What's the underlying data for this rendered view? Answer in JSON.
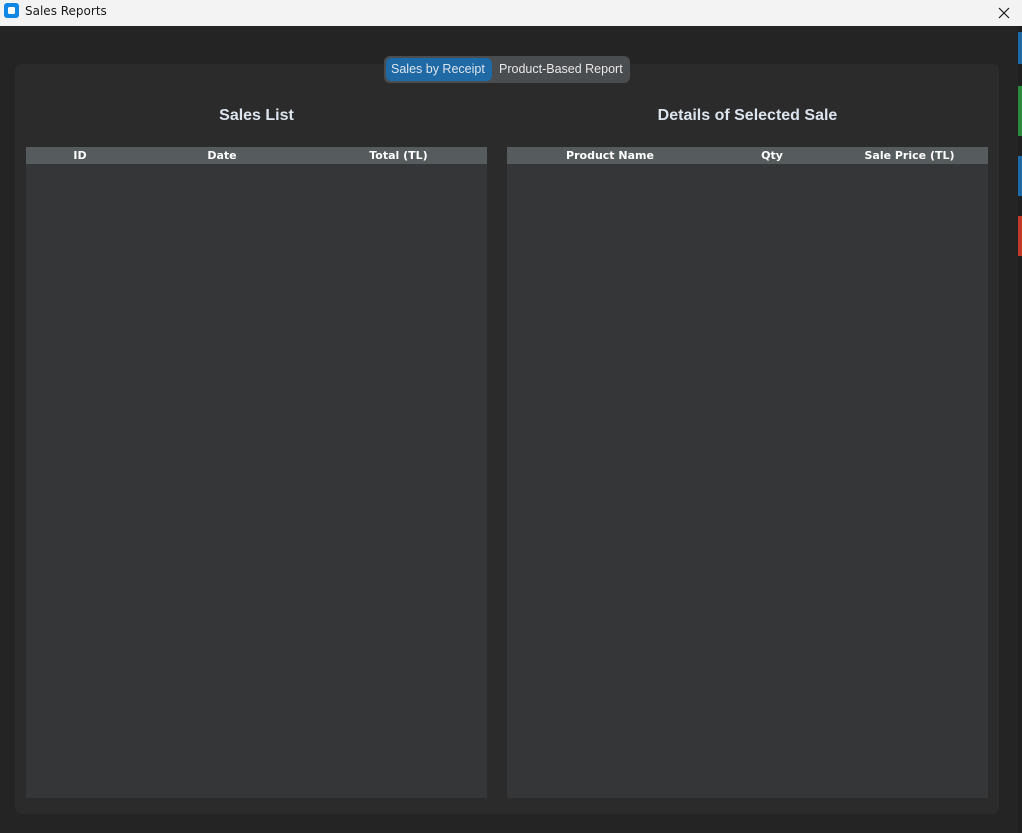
{
  "window": {
    "title": "Sales Reports",
    "accent": "#1f6aa5"
  },
  "tabs": [
    {
      "label": "Sales by Receipt",
      "active": true
    },
    {
      "label": "Product-Based Report",
      "active": false
    }
  ],
  "sales_list": {
    "title": "Sales List",
    "columns": [
      "ID",
      "Date",
      "Total (TL)"
    ],
    "rows": []
  },
  "sale_details": {
    "title": "Details of Selected Sale",
    "columns": [
      "Product Name",
      "Qty",
      "Sale Price (TL)"
    ],
    "rows": []
  },
  "icons": {
    "app": "app-window-icon",
    "close": "close-icon"
  }
}
